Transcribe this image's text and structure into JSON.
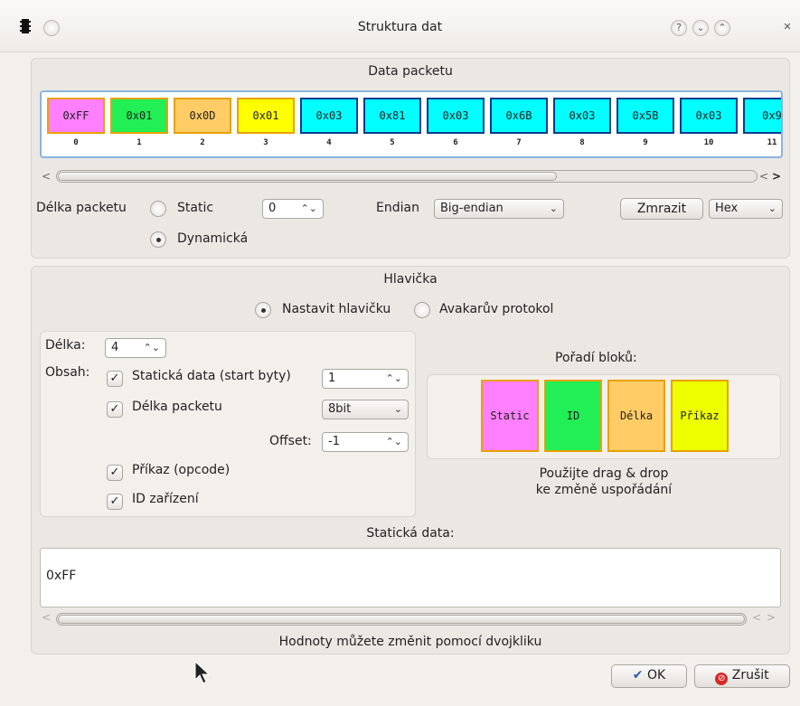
{
  "window": {
    "title": "Struktura dat",
    "buttons": {
      "help": "?",
      "minimize": "⌄",
      "maximize": "⌃",
      "close": "✕"
    }
  },
  "packet": {
    "section_title": "Data packetu",
    "bytes": [
      {
        "value": "0xFF",
        "index": "0",
        "color": "#ff80ff"
      },
      {
        "value": "0x01",
        "index": "1",
        "color": "#22ee55"
      },
      {
        "value": "0x0D",
        "index": "2",
        "color": "#ffcc66"
      },
      {
        "value": "0x01",
        "index": "3",
        "color": "#ffff00"
      },
      {
        "value": "0x03",
        "index": "4",
        "color": "#00ffff"
      },
      {
        "value": "0x81",
        "index": "5",
        "color": "#00ffff"
      },
      {
        "value": "0x03",
        "index": "6",
        "color": "#00ffff"
      },
      {
        "value": "0x6B",
        "index": "7",
        "color": "#00ffff"
      },
      {
        "value": "0x03",
        "index": "8",
        "color": "#00ffff"
      },
      {
        "value": "0x5B",
        "index": "9",
        "color": "#00ffff"
      },
      {
        "value": "0x03",
        "index": "10",
        "color": "#00ffff"
      },
      {
        "value": "0x9",
        "index": "11",
        "color": "#00ffff"
      }
    ],
    "length_label": "Délka packetu",
    "static_label": "Static",
    "dynamic_label": "Dynamická",
    "static_value": "0",
    "endian_label": "Endian",
    "endian_value": "Big-endian",
    "freeze_button": "Zmrazit",
    "format_value": "Hex"
  },
  "header": {
    "section_title": "Hlavička",
    "set_header_label": "Nastavit hlavičku",
    "avakar_label": "Avakarův protokol",
    "length_label": "Délka:",
    "length_value": "4",
    "content_label": "Obsah:",
    "static_data_label": "Statická data (start byty)",
    "static_data_value": "1",
    "packet_length_label": "Délka packetu",
    "packet_length_type": "8bit",
    "offset_label": "Offset:",
    "offset_value": "-1",
    "command_label": "Příkaz (opcode)",
    "device_id_label": "ID zařízení",
    "order_title": "Pořadí bloků:",
    "blocks": [
      {
        "label": "Static",
        "color": "#ff80ff"
      },
      {
        "label": "ID",
        "color": "#22ee55"
      },
      {
        "label": "Délka",
        "color": "#ffcc66"
      },
      {
        "label": "Příkaz",
        "color": "#eeff00"
      }
    ],
    "dnd_hint_1": "Použijte drag & drop",
    "dnd_hint_2": "ke změně uspořádání",
    "static_data_title": "Statická data:",
    "static_data_content": "0xFF",
    "edit_hint": "Hodnoty můžete změnit pomocí dvojkliku"
  },
  "footer": {
    "ok_label": "OK",
    "cancel_label": "Zrušit"
  }
}
